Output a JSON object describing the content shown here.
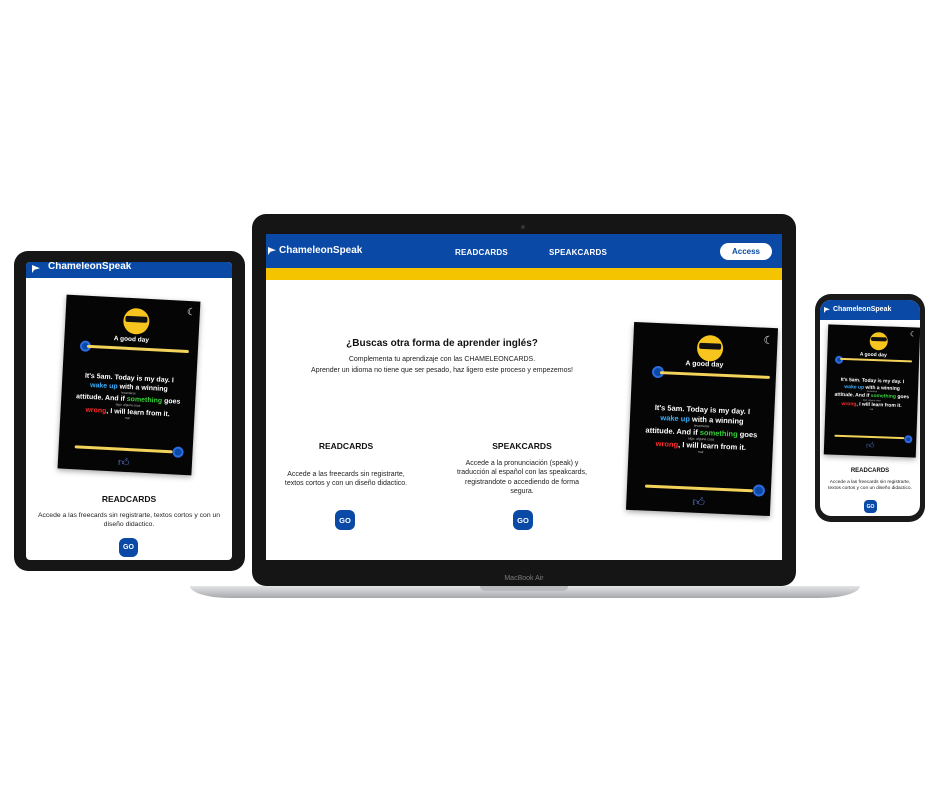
{
  "brand": {
    "name": "ChameleonSpeak"
  },
  "nav": {
    "readcards": "READCARDS",
    "speakcards": "SPEAKCARDS",
    "access": "Access"
  },
  "hero": {
    "title": "¿Buscas otra forma de aprender inglés?",
    "line1": "Complementa tu aprendizaje con las CHAMELEONCARDS.",
    "line2": "Aprender un idioma no tiene que ser pesado, haz ligero este proceso y empezemos!"
  },
  "features": [
    {
      "title": "READCARDS",
      "desc": "Accede a las freecards sin registrarte, textos cortos y con un diseño didactico.",
      "button": "GO"
    },
    {
      "title": "SPEAKCARDS",
      "desc": "Accede a la pronunciación (speak) y traducción al español con las speakcards, registrandote o accediendo de forma segura.",
      "button": "GO"
    }
  ],
  "card": {
    "caption": "A good day",
    "line1": "It's 5am. Today is my day. I",
    "wake_up": "wake up",
    "wake_up_gloss": "levantarse",
    "line2_rest": " with a winning",
    "line3_pre": "attitude. And if ",
    "something": "something",
    "something_gloss": "algo, alguna cosa",
    "line3_post": " goes",
    "wrong": "wrong",
    "wrong_gloss": "mal",
    "line4_rest": ", I will learn from it."
  },
  "tablet": {
    "section_title": "READCARDS",
    "desc": "Accede a las freecards sin registrarte, textos cortos y con un diseño didactico.",
    "button": "GO"
  },
  "phone": {
    "section_title": "READCARDS",
    "desc": "Accede a las freecards sin registrarte, textos cortos y con un diseño didactico.",
    "button": "GO"
  },
  "device_label": "MacBook Air",
  "colors": {
    "primary": "#0a4aa6",
    "accent": "#f4c400",
    "card_bg": "#050505"
  }
}
